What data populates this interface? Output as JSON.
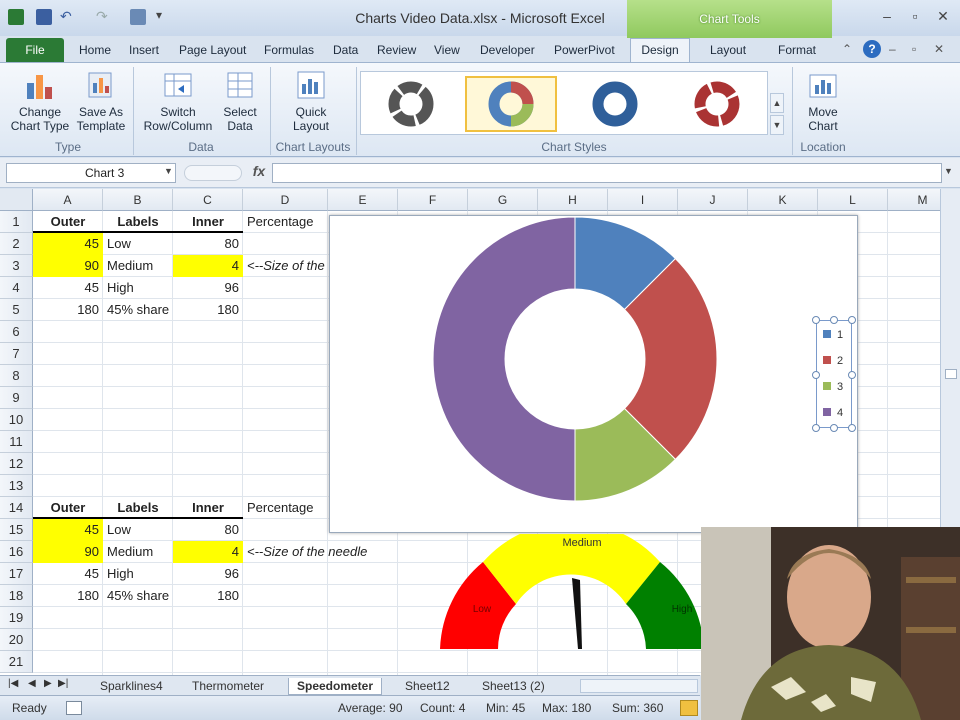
{
  "window": {
    "title": "Charts Video Data.xlsx - Microsoft Excel",
    "context_tab_group": "Chart Tools"
  },
  "tabs": [
    "File",
    "Home",
    "Insert",
    "Page Layout",
    "Formulas",
    "Data",
    "Review",
    "View",
    "Developer",
    "PowerPivot",
    "Design",
    "Layout",
    "Format"
  ],
  "ribbon": {
    "change_chart_type": "Change Chart Type",
    "save_as_template": "Save As Template",
    "group_type": "Type",
    "switch_row_column": "Switch Row/Column",
    "select_data": "Select Data",
    "group_data": "Data",
    "quick_layout": "Quick Layout",
    "group_chart_layouts": "Chart Layouts",
    "group_chart_styles": "Chart Styles",
    "move_chart": "Move Chart",
    "group_location": "Location"
  },
  "formula_bar": {
    "name_box": "Chart 3",
    "fx": "fx",
    "value": ""
  },
  "columns": [
    "A",
    "B",
    "C",
    "D",
    "E",
    "F",
    "G",
    "H",
    "I",
    "J",
    "K",
    "L",
    "M"
  ],
  "rows": [
    "1",
    "2",
    "3",
    "4",
    "5",
    "6",
    "7",
    "8",
    "9",
    "10",
    "11",
    "12",
    "13",
    "14",
    "15",
    "16",
    "17",
    "18",
    "19",
    "20",
    "21"
  ],
  "cells": {
    "A1": "Outer",
    "B1": "Labels",
    "C1": "Inner",
    "D1": "Percentage",
    "A2": "45",
    "B2": "Low",
    "C2": "80",
    "A3": "90",
    "B3": "Medium",
    "C3": "4",
    "D3": "<--Size of the",
    "A4": "45",
    "B4": "High",
    "C4": "96",
    "A5": "180",
    "B5": "45% share",
    "C5": "180",
    "A14": "Outer",
    "B14": "Labels",
    "C14": "Inner",
    "D14": "Percentage",
    "A15": "45",
    "B15": "Low",
    "C15": "80",
    "A16": "90",
    "B16": "Medium",
    "C16": "4",
    "D16": "<--Size of the needle",
    "A17": "45",
    "B17": "High",
    "C17": "96",
    "A18": "180",
    "B18": "45% share",
    "C18": "180"
  },
  "chart_data": {
    "type": "pie",
    "variant": "doughnut",
    "categories": [
      "1",
      "2",
      "3",
      "4"
    ],
    "values": [
      45,
      90,
      45,
      180
    ],
    "colors": [
      "#4f81bd",
      "#c0504d",
      "#9bbb59",
      "#8064a2"
    ],
    "legend": "right"
  },
  "speedometer": {
    "labels": [
      "Low",
      "Medium",
      "High"
    ],
    "colors": [
      "#ff0000",
      "#ffff00",
      "#008000"
    ]
  },
  "sheet_tabs": [
    "Sparklines4",
    "Thermometer",
    "Speedometer",
    "Sheet12",
    "Sheet13 (2)"
  ],
  "active_sheet": "Speedometer",
  "status": {
    "ready": "Ready",
    "average": "Average: 90",
    "count": "Count: 4",
    "min": "Min: 45",
    "max": "Max: 180",
    "sum": "Sum: 360"
  }
}
